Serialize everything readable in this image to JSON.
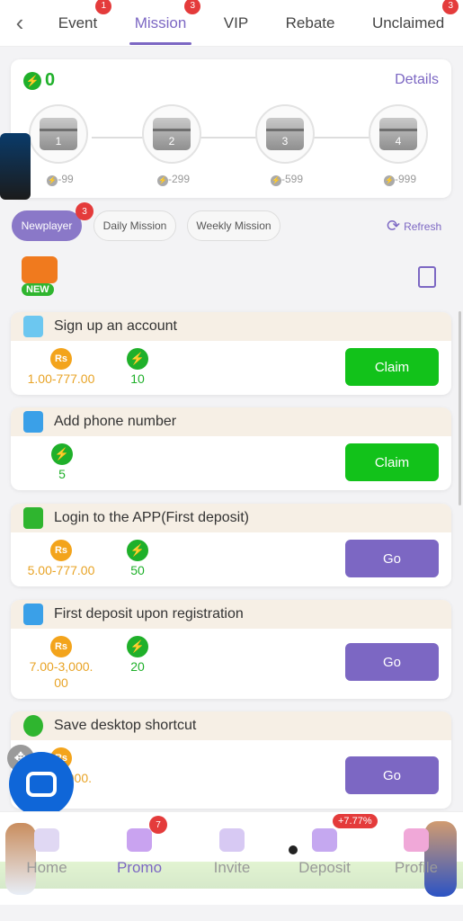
{
  "nav": {
    "tabs": [
      {
        "label": "Event",
        "badge": "1"
      },
      {
        "label": "Mission",
        "badge": "3",
        "active": true
      },
      {
        "label": "VIP",
        "badge": ""
      },
      {
        "label": "Rebate",
        "badge": ""
      },
      {
        "label": "Unclaimed",
        "badge": "3"
      }
    ]
  },
  "progress": {
    "points": "0",
    "details": "Details",
    "chests": [
      {
        "label": "1",
        "cost": "-99"
      },
      {
        "label": "2",
        "cost": "-299"
      },
      {
        "label": "3",
        "cost": "-599"
      },
      {
        "label": "4",
        "cost": "-999"
      }
    ]
  },
  "filters": {
    "newplayer": "Newplayer",
    "newplayer_badge": "3",
    "daily": "Daily Mission",
    "weekly": "Weekly Mission",
    "refresh": "Refresh",
    "new_tag": "NEW"
  },
  "tasks": [
    {
      "title": "Sign up an account",
      "coin": "Rs",
      "amount": "1.00-777.00",
      "points": "10",
      "button": "Claim"
    },
    {
      "title": "Add phone number",
      "points": "5",
      "button": "Claim"
    },
    {
      "title": "Login to the APP(First deposit)",
      "coin": "Rs",
      "amount": "5.00-777.00",
      "points": "50",
      "button": "Go"
    },
    {
      "title": "First deposit upon registration",
      "coin": "Rs",
      "amount1": "7.00-3,000.",
      "amount2": "00",
      "points": "20",
      "button": "Go"
    },
    {
      "title": "Save desktop shortcut",
      "coin": "Rs",
      "amount_partial": "000.",
      "button": "Go"
    }
  ],
  "bottom": {
    "home": "Home",
    "promo": "Promo",
    "promo_badge": "7",
    "invite": "Invite",
    "deposit": "Deposit",
    "deposit_badge": "+7.77%",
    "profile": "Profile"
  },
  "colors": {
    "accent": "#7c67c3",
    "green": "#12c21a",
    "coin": "#f3a41c",
    "badge": "#e43b3b"
  }
}
